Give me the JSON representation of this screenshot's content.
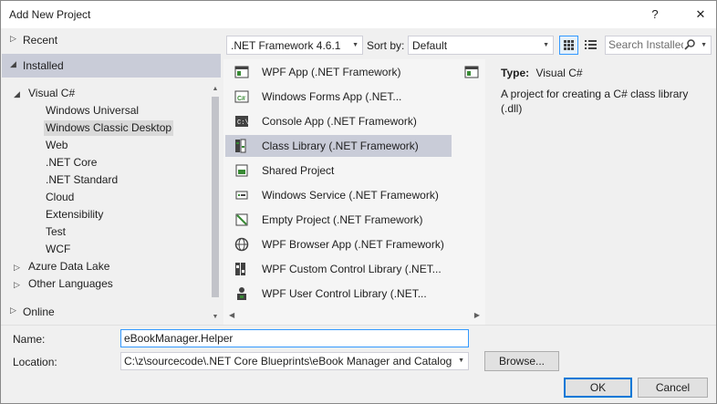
{
  "window": {
    "title": "Add New Project",
    "help": "?",
    "close": "✕"
  },
  "nav": {
    "recent": "Recent",
    "installed": "Installed",
    "online": "Online",
    "tree": [
      {
        "label": "Visual C#",
        "expanded": true
      },
      {
        "label": "Windows Universal"
      },
      {
        "label": "Windows Classic Desktop",
        "selected": true
      },
      {
        "label": "Web"
      },
      {
        "label": ".NET Core"
      },
      {
        "label": ".NET Standard"
      },
      {
        "label": "Cloud"
      },
      {
        "label": "Extensibility"
      },
      {
        "label": "Test"
      },
      {
        "label": "WCF"
      },
      {
        "label": "Azure Data Lake",
        "expanded": false
      },
      {
        "label": "Other Languages",
        "expanded": false
      }
    ]
  },
  "toolbar": {
    "framework": ".NET Framework 4.6.1",
    "sort_label": "Sort by:",
    "sort_value": "Default",
    "search_placeholder": "Search Installed"
  },
  "templates": [
    {
      "name": "WPF App (.NET Framework)",
      "icon": "wpf-app-icon"
    },
    {
      "name": "Windows Forms App (.NET...",
      "icon": "winforms-icon"
    },
    {
      "name": "Console App (.NET Framework)",
      "icon": "console-icon"
    },
    {
      "name": "Class Library (.NET Framework)",
      "icon": "class-library-icon",
      "selected": true
    },
    {
      "name": "Shared Project",
      "icon": "shared-project-icon"
    },
    {
      "name": "Windows Service (.NET Framework)",
      "icon": "windows-service-icon"
    },
    {
      "name": "Empty Project (.NET Framework)",
      "icon": "empty-project-icon"
    },
    {
      "name": "WPF Browser App (.NET Framework)",
      "icon": "globe-icon"
    },
    {
      "name": "WPF Custom Control Library (.NET...",
      "icon": "custom-control-icon"
    },
    {
      "name": "WPF User Control Library (.NET...",
      "icon": "user-control-icon"
    }
  ],
  "details": {
    "type_label": "Type:",
    "type_value": "Visual C#",
    "description": "A project for creating a C# class library (.dll)"
  },
  "form": {
    "name_label": "Name:",
    "name_value": "eBookManager.Helper",
    "location_label": "Location:",
    "location_value": "C:\\z\\sourcecode\\.NET Core Blueprints\\eBook Manager and Catalog",
    "browse": "Browse...",
    "ok": "OK",
    "cancel": "Cancel"
  },
  "colors": {
    "accent": "#0078d7",
    "selection": "#c9ccd8"
  }
}
